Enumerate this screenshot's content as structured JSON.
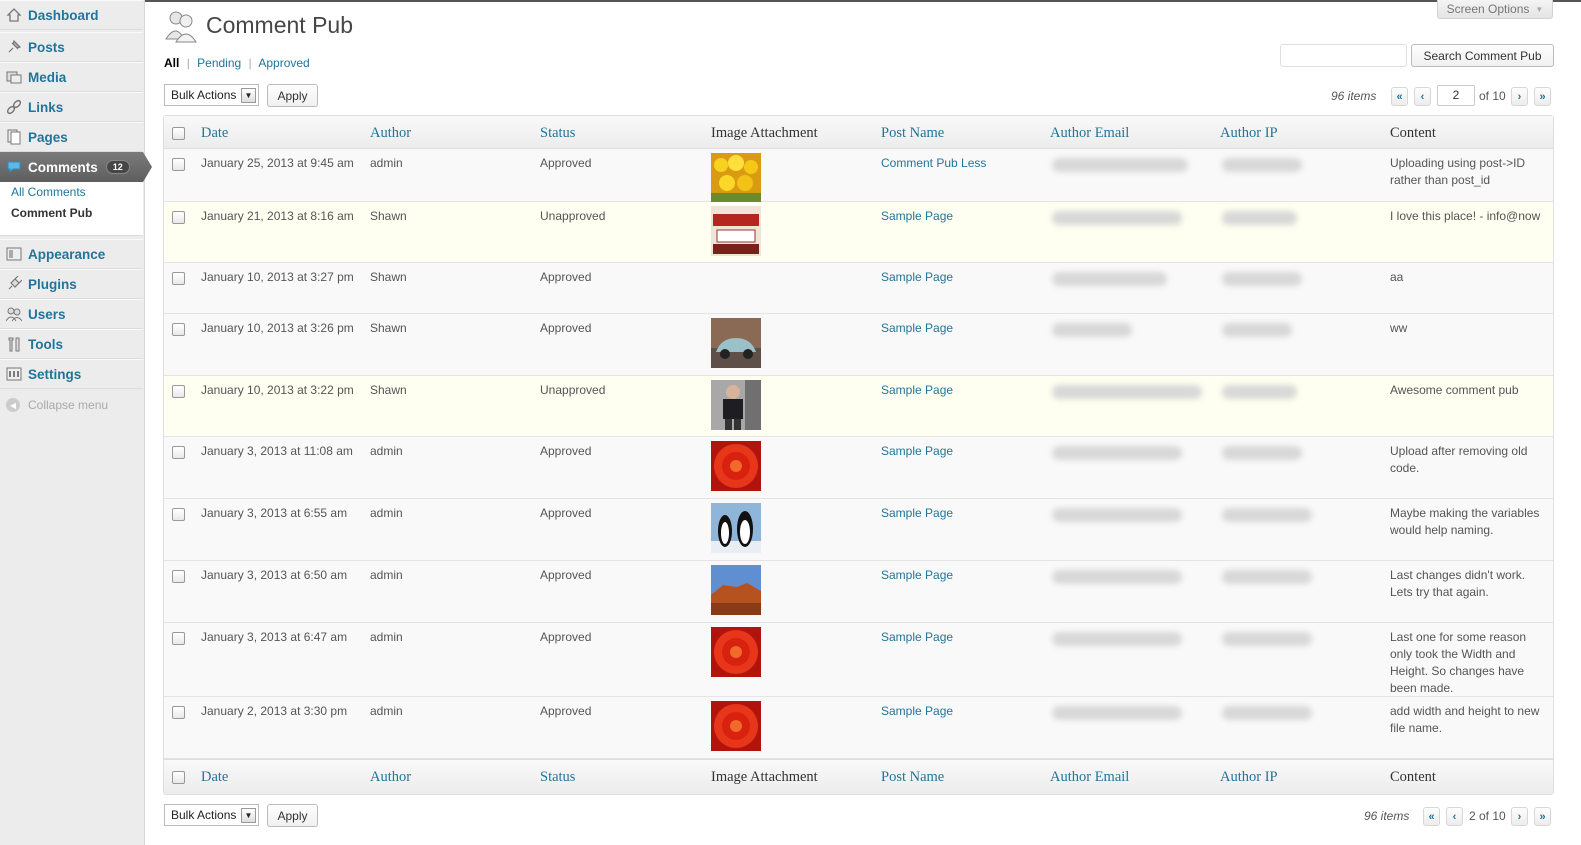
{
  "sidebar": {
    "items": [
      {
        "label": "Dashboard",
        "icon": "dashboard-icon"
      },
      {
        "label": "Posts",
        "icon": "pin-icon"
      },
      {
        "label": "Media",
        "icon": "media-icon"
      },
      {
        "label": "Links",
        "icon": "link-icon"
      },
      {
        "label": "Pages",
        "icon": "pages-icon"
      },
      {
        "label": "Comments",
        "icon": "comment-bubble-icon",
        "badge": "12"
      },
      {
        "label": "Appearance",
        "icon": "appearance-icon"
      },
      {
        "label": "Plugins",
        "icon": "plugin-icon"
      },
      {
        "label": "Users",
        "icon": "users-icon"
      },
      {
        "label": "Tools",
        "icon": "tools-icon"
      },
      {
        "label": "Settings",
        "icon": "settings-icon"
      }
    ],
    "submenu": [
      "All Comments",
      "Comment Pub"
    ],
    "collapse_label": "Collapse menu"
  },
  "header": {
    "title": "Comment Pub",
    "screen_options": "Screen Options"
  },
  "filters": {
    "all": "All",
    "sep1": "|",
    "pending": "Pending",
    "sep2": "|",
    "approved": "Approved"
  },
  "search": {
    "button": "Search Comment Pub",
    "value": ""
  },
  "tablenav_top": {
    "bulk_actions": "Bulk Actions",
    "apply": "Apply",
    "items": "96 items",
    "first": "«",
    "prev": "‹",
    "page": "2",
    "of": "of 10",
    "next": "›",
    "last": "»"
  },
  "tablenav_bottom": {
    "bulk_actions": "Bulk Actions",
    "apply": "Apply",
    "items": "96 items",
    "first": "«",
    "prev": "‹",
    "page_of": "2 of 10",
    "next": "›",
    "last": "»"
  },
  "columns": [
    "Date",
    "Author",
    "Status",
    "Image Attachment",
    "Post Name",
    "Author Email",
    "Author IP",
    "Content"
  ],
  "rows": [
    {
      "date": "January 25, 2013 at 9:45 am",
      "author": "admin",
      "status": "Approved",
      "image": "yellow-tulips",
      "post": "Comment Pub Less",
      "content": "Uploading using post->ID rather than post_id"
    },
    {
      "date": "January 21, 2013 at 8:16 am",
      "author": "Shawn",
      "status": "Unapproved",
      "image": "storefront",
      "post": "Sample Page",
      "content": "I love this place! - info@now"
    },
    {
      "date": "January 10, 2013 at 3:27 pm",
      "author": "Shawn",
      "status": "Approved",
      "image": "",
      "post": "Sample Page",
      "content": "aa"
    },
    {
      "date": "January 10, 2013 at 3:26 pm",
      "author": "Shawn",
      "status": "Approved",
      "image": "vintage-car",
      "post": "Sample Page",
      "content": "ww"
    },
    {
      "date": "January 10, 2013 at 3:22 pm",
      "author": "Shawn",
      "status": "Unapproved",
      "image": "person",
      "post": "Sample Page",
      "content": "Awesome comment pub"
    },
    {
      "date": "January 3, 2013 at 11:08 am",
      "author": "admin",
      "status": "Approved",
      "image": "red-flower",
      "post": "Sample Page",
      "content": "Upload after removing old code."
    },
    {
      "date": "January 3, 2013 at 6:55 am",
      "author": "admin",
      "status": "Approved",
      "image": "penguins",
      "post": "Sample Page",
      "content": "Maybe making the variables would help naming."
    },
    {
      "date": "January 3, 2013 at 6:50 am",
      "author": "admin",
      "status": "Approved",
      "image": "desert",
      "post": "Sample Page",
      "content": "Last changes didn't work. Lets try that again."
    },
    {
      "date": "January 3, 2013 at 6:47 am",
      "author": "admin",
      "status": "Approved",
      "image": "red-flower",
      "post": "Sample Page",
      "content": "Last one for some reason only took the Width and Height. So changes have been made."
    },
    {
      "date": "January 2, 2013 at 3:30 pm",
      "author": "admin",
      "status": "Approved",
      "image": "red-flower",
      "post": "Sample Page",
      "content": "add width and height to new file name."
    }
  ],
  "colors": {
    "link": "#21759b",
    "unapproved_bg": "#fefff0",
    "active_menu": "#6d6d6d"
  }
}
